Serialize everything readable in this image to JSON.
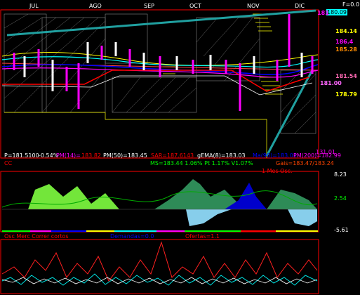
{
  "header": {
    "f_readout": "F=0.0",
    "months": [
      "JUL",
      "AGO",
      "SEP",
      "OCT",
      "NOV",
      "DIC"
    ]
  },
  "price_panel": {
    "current_price_tag": "180.09",
    "price_labels": [
      {
        "text": "184.14",
        "color": "#ffff00"
      },
      {
        "text": "186.4",
        "color": "#ff00ff"
      },
      {
        "text": "185.28",
        "color": "#ff8c00"
      },
      {
        "text": "181.54",
        "color": "#ff69b4"
      },
      {
        "text": "181.00",
        "color": "#ff66ff"
      },
      {
        "text": "178.79",
        "color": "#ffff00"
      }
    ],
    "top_left_value": "181",
    "stats_row1": [
      {
        "text": "P=181.5100",
        "color": "#ffffff"
      },
      {
        "text": "-0.54%",
        "color": "#ffffff"
      },
      {
        "text": "PM(14)=",
        "color": "#ff00ff"
      },
      {
        "text": "183.82",
        "color": "#ff0000"
      },
      {
        "text": "PM(50)=183.45",
        "color": "#ffffff"
      },
      {
        "text": "SAR=187.6143",
        "color": "#ff0000"
      },
      {
        "text": "gEMA(8)=183.03",
        "color": "#ffffff"
      },
      {
        "text": "Ma(90)=183.01",
        "color": "#0000ff"
      },
      {
        "text": "PM(200)=182.99",
        "color": "#ff00ff"
      }
    ],
    "stats_row2": [
      {
        "text": "CC",
        "color": "#ff0000"
      },
      {
        "text": "MS=183.44 1.06% Pt 1.17% V1.07%",
        "color": "#00ff00"
      },
      {
        "text": "Gais=183.47/183.24",
        "color": "#ff4500"
      }
    ],
    "bottom_right_value": "131.01"
  },
  "oscillator_panel": {
    "title": "1 Mes Osc.",
    "title_color": "#ff0000",
    "scale": [
      "8.23",
      "2.54",
      "-5.61"
    ],
    "scale_colors": [
      "#ffffff",
      "#00ff00",
      "#ffffff"
    ]
  },
  "bottom_panel": {
    "left_label": "Osc Merc Correr cortos",
    "left_color": "#ff0000",
    "mid_label": "Demandas=0.0",
    "mid_color": "#0000ff",
    "right_label": "Ofertas=1.1",
    "right_color": "#ff0000"
  },
  "colors": {
    "background": "#000000",
    "frame": "#ff0000",
    "trend_line": "#20a0a0",
    "grid_fill": "#c0c0c0"
  }
}
